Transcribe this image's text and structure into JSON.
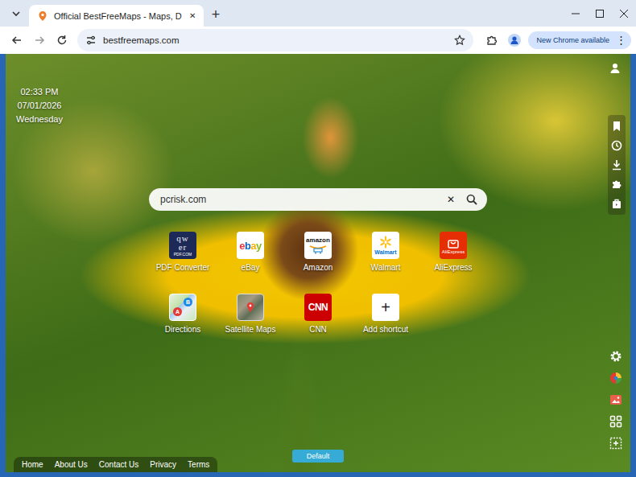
{
  "window": {
    "tab_title": "Official BestFreeMaps - Maps, D",
    "tab_close": "✕",
    "new_tab": "+"
  },
  "toolbar": {
    "url": "bestfreemaps.com",
    "update_button": "New Chrome available",
    "menu": "⋮"
  },
  "clock": {
    "time": "02:33 PM",
    "date": "07/01/2026",
    "day": "Wednesday"
  },
  "search": {
    "value": "pcrisk.com",
    "clear": "✕"
  },
  "shortcuts": [
    {
      "label": "PDF Converter",
      "kind": "pdf",
      "logo_text": [
        "qw",
        "er",
        "PDF.COM"
      ]
    },
    {
      "label": "eBay",
      "kind": "ebay",
      "logo_text": [
        "ebay"
      ]
    },
    {
      "label": "Amazon",
      "kind": "amazon",
      "logo_text": [
        "amazon"
      ]
    },
    {
      "label": "Walmart",
      "kind": "walmart",
      "logo_text": [
        "Walmart"
      ]
    },
    {
      "label": "AliExpress",
      "kind": "aliexpress",
      "logo_text": [
        "AliExpress"
      ]
    },
    {
      "label": "Directions",
      "kind": "directions",
      "logo_text": [
        "A",
        "B"
      ]
    },
    {
      "label": "Satellite Maps",
      "kind": "satellite",
      "logo_text": []
    },
    {
      "label": "CNN",
      "kind": "cnn",
      "logo_text": [
        "CNN"
      ]
    },
    {
      "label": "Add shortcut",
      "kind": "add",
      "logo_text": [
        "+"
      ]
    }
  ],
  "footer": [
    "Home",
    "About Us",
    "Contact Us",
    "Privacy",
    "Terms"
  ],
  "theme_button": "Default"
}
